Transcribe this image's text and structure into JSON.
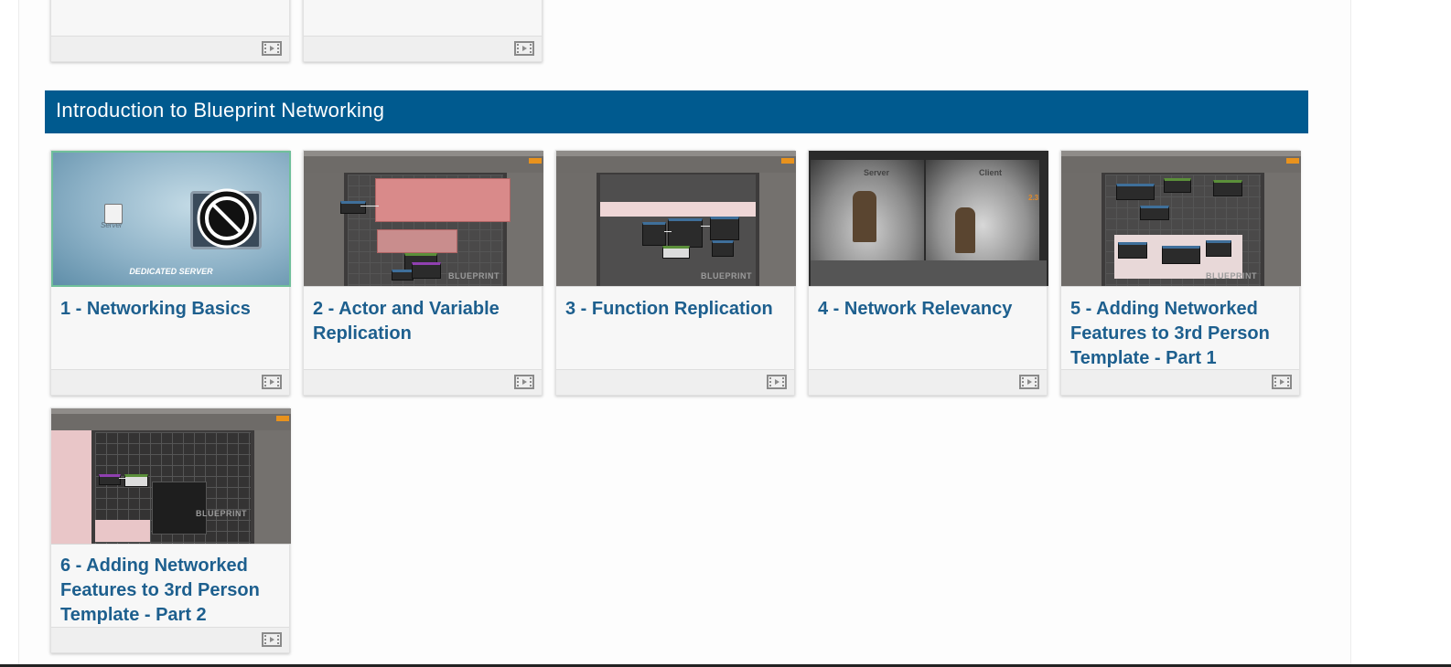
{
  "section": {
    "title": "Introduction to Blueprint Networking"
  },
  "videos": [
    {
      "title": "1 - Networking Basics",
      "thumb_text": [
        "DEDICATED SERVER",
        "Server"
      ]
    },
    {
      "title": "2 - Actor and Variable Replication",
      "thumb_text": [
        "BLUEPRINT"
      ]
    },
    {
      "title": "3 - Function Replication",
      "thumb_text": [
        "BLUEPRINT"
      ]
    },
    {
      "title": "4 - Network Relevancy",
      "thumb_text": [
        "Server",
        "Client",
        "2.3"
      ]
    },
    {
      "title": "5 - Adding Networked Features to 3rd Person Template - Part 1",
      "thumb_text": [
        "BLUEPRINT"
      ]
    },
    {
      "title": "6 - Adding Networked Features to 3rd Person Template - Part 2",
      "thumb_text": [
        "BLUEPRINT"
      ]
    }
  ],
  "icons": {
    "video": "film-icon",
    "no_entry": "no-entry-icon"
  },
  "colors": {
    "header_bg": "#005a8f",
    "link": "#1d5f8e"
  }
}
